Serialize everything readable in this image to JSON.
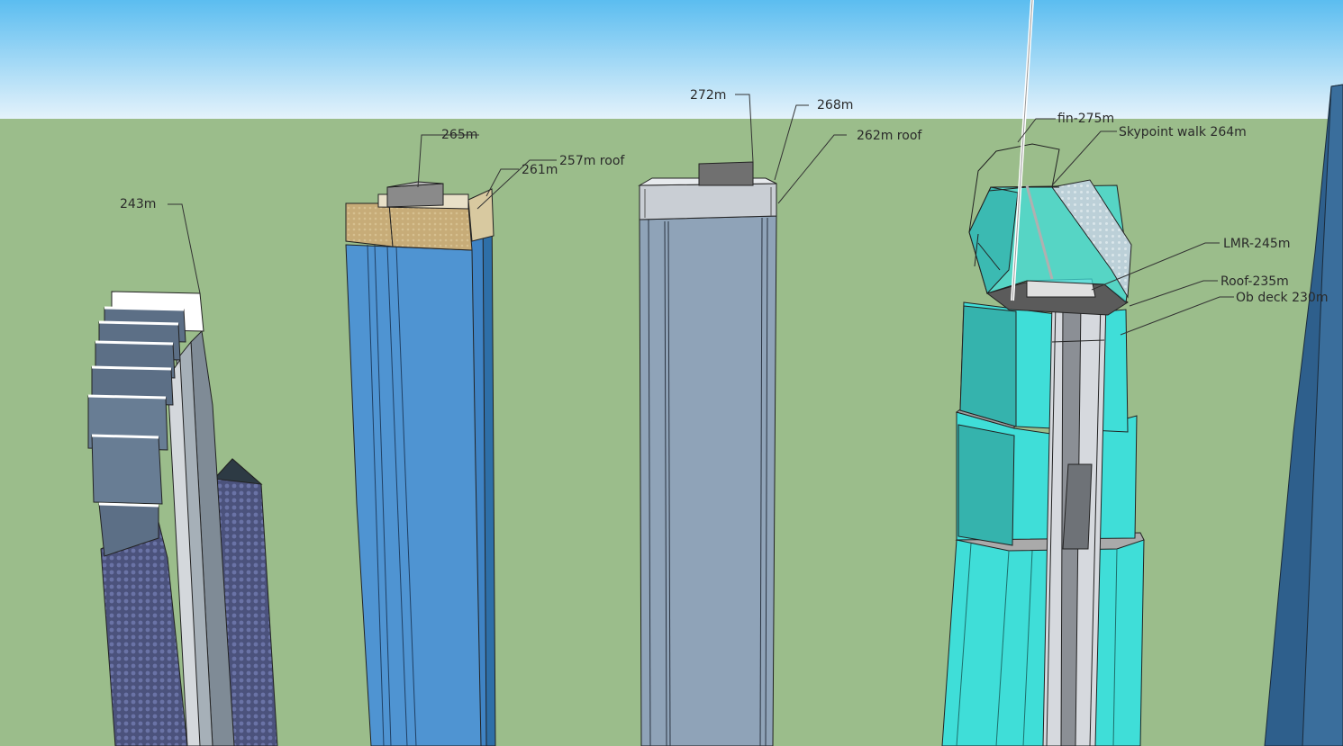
{
  "labels": {
    "tower1_height": "243m",
    "tower2_top": "265m",
    "tower2_mid": "261m",
    "tower2_roof": "257m roof",
    "tower3_top": "272m",
    "tower3_mid": "268m",
    "tower3_roof": "262m roof",
    "tower4_fin": "fin-275m",
    "tower4_skypoint": "Skypoint walk 264m",
    "tower4_lmr": "LMR-245m",
    "tower4_roof": "Roof-235m",
    "tower4_obdeck": "Ob deck 230m"
  },
  "colors": {
    "sky_top": "#5bbdf0",
    "sky_bottom": "#e4f2fb",
    "ground": "#9bbd8b",
    "tower1_glass": "#5c6f86",
    "tower1_pattern": "#4b527c",
    "tower2_blue": "#4f94d2",
    "tower2_crown": "#c7ac78",
    "tower3_grey": "#8fa3b8",
    "tower4_cyan": "#3fded8",
    "tower4_teal": "#35b3ad",
    "tower5_blue": "#2e5f8c"
  }
}
